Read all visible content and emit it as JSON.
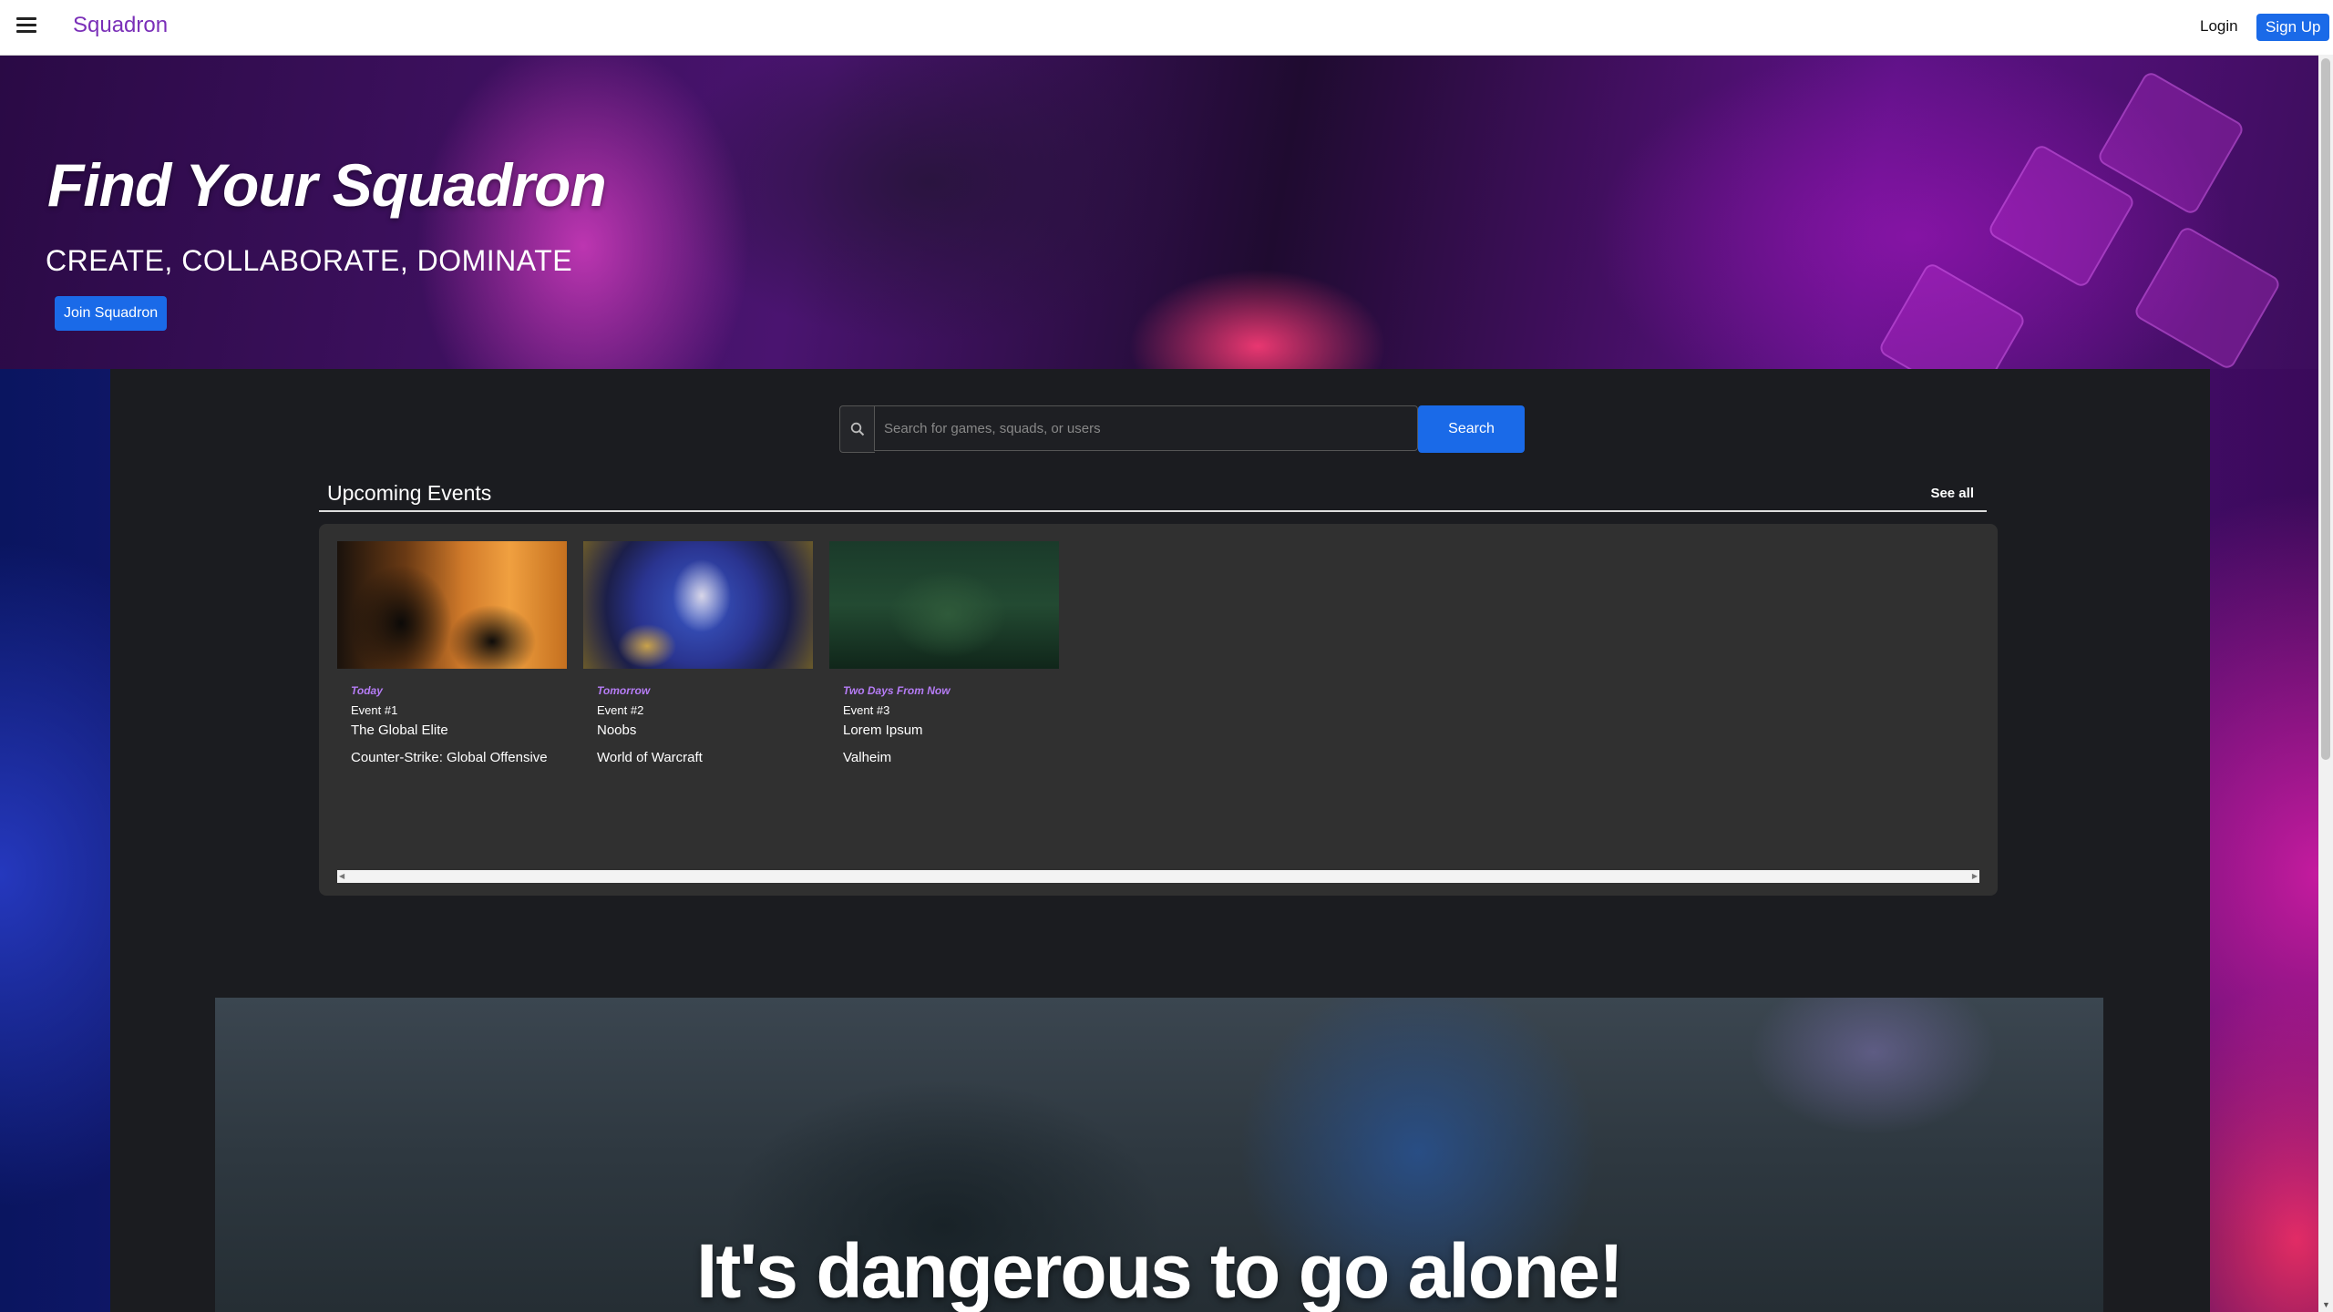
{
  "navbar": {
    "brand": "Squadron",
    "login_label": "Login",
    "signup_label": "Sign Up"
  },
  "hero": {
    "title": "Find Your Squadron",
    "subtitle": "CREATE, COLLABORATE, DOMINATE",
    "cta_label": "Join Squadron"
  },
  "search": {
    "placeholder": "Search for games, squads, or users",
    "value": "",
    "button_label": "Search"
  },
  "events": {
    "title": "Upcoming Events",
    "see_all_label": "See all",
    "cards": [
      {
        "date": "Today",
        "event": "Event #1",
        "name": "The Global Elite",
        "game": "Counter-Strike: Global Offensive"
      },
      {
        "date": "Tomorrow",
        "event": "Event #2",
        "name": "Noobs",
        "game": "World of Warcraft"
      },
      {
        "date": "Two Days From Now",
        "event": "Event #3",
        "name": "Lorem Ipsum",
        "game": "Valheim"
      }
    ]
  },
  "banner": {
    "title": "It's dangerous to go alone!"
  },
  "colors": {
    "brand": "#7a2fb8",
    "accent_blue": "#1a6ae8",
    "date_purple": "#b57cf5",
    "panel_bg": "#1b1c20",
    "card_area_bg": "#303030"
  },
  "icons": {
    "menu": "hamburger-icon",
    "search": "search-icon"
  }
}
